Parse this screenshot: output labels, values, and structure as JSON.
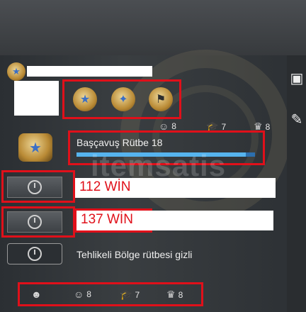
{
  "profile": {
    "rank_name": "Başçavuş Rütbe 18",
    "rank_progress": 0.95,
    "stats": [
      {
        "icon": "smiley-icon",
        "value": "8"
      },
      {
        "icon": "mortarboard-icon",
        "value": "7"
      },
      {
        "icon": "crown-icon",
        "value": "8"
      }
    ]
  },
  "wingman": {
    "wins": "112 WİN"
  },
  "competitive": {
    "wins": "137 WİN"
  },
  "danger_zone": {
    "label": "Tehlikeli Bölge rütbesi gizli"
  },
  "bottom_stats": [
    {
      "icon": "face-icon",
      "value": ""
    },
    {
      "icon": "smiley-icon",
      "value": "8"
    },
    {
      "icon": "mortarboard-icon",
      "value": "7"
    },
    {
      "icon": "crown-icon",
      "value": "8"
    }
  ],
  "watermark": "itemsatis",
  "colors": {
    "highlight_red": "#e0101a",
    "progress_blue": "#56b4ee"
  }
}
